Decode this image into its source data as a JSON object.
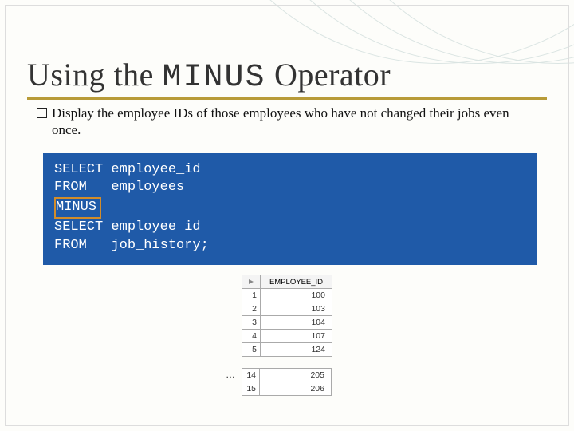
{
  "title_pre": "Using the",
  "title_mono": "MINUS",
  "title_post": "Operator",
  "bullet_text": "Display the employee IDs of those employees who have not changed their jobs even once.",
  "code": {
    "l1": "SELECT employee_id",
    "l2": "FROM   employees",
    "l3": "MINUS",
    "l4": "SELECT employee_id",
    "l5": "FROM   job_history;"
  },
  "result": {
    "column": "EMPLOYEE_ID",
    "top_rows": [
      {
        "n": "1",
        "v": "100"
      },
      {
        "n": "2",
        "v": "103"
      },
      {
        "n": "3",
        "v": "104"
      },
      {
        "n": "4",
        "v": "107"
      },
      {
        "n": "5",
        "v": "124"
      }
    ],
    "ellipsis": "…",
    "bottom_rows": [
      {
        "n": "14",
        "v": "205"
      },
      {
        "n": "15",
        "v": "206"
      }
    ]
  }
}
